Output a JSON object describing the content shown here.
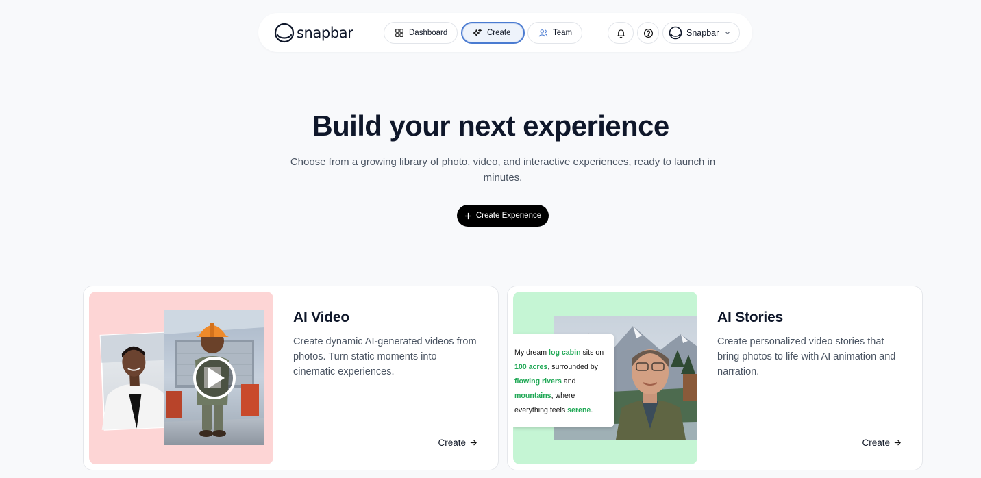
{
  "brand": {
    "name": "snapbar"
  },
  "nav": {
    "items": [
      {
        "label": "Dashboard",
        "icon": "grid-icon"
      },
      {
        "label": "Create",
        "icon": "sparkles-icon"
      },
      {
        "label": "Team",
        "icon": "users-icon"
      }
    ],
    "active": "Create",
    "account_label": "Snapbar"
  },
  "hero": {
    "title": "Build your next experience",
    "subtitle": "Choose from a growing library of photo, video, and interactive experiences, ready to launch in minutes.",
    "cta_label": "Create Experience"
  },
  "cards": [
    {
      "title": "AI Video",
      "description": "Create dynamic AI-generated videos from photos. Turn static moments into cinematic experiences.",
      "link_label": "Create",
      "media_bg": "#fdd5d5"
    },
    {
      "title": "AI Stories",
      "description": "Create personalized video stories that bring photos to life with AI animation and narration.",
      "link_label": "Create",
      "media_bg": "#c5f5d4",
      "caption": {
        "t1": "My dream ",
        "h1": "log cabin",
        "t2": " sits on",
        "h2": "100 acres",
        "t3": ", surrounded by",
        "h3": "flowing rivers",
        "t4": " and",
        "h4": "mountains",
        "t5": ", where",
        "t6": "everything feels ",
        "h5": "serene",
        "t7": "."
      }
    }
  ],
  "colors": {
    "accent": "#4a7bd1",
    "highlight": "#1fa855",
    "cta_bg": "#000000"
  }
}
